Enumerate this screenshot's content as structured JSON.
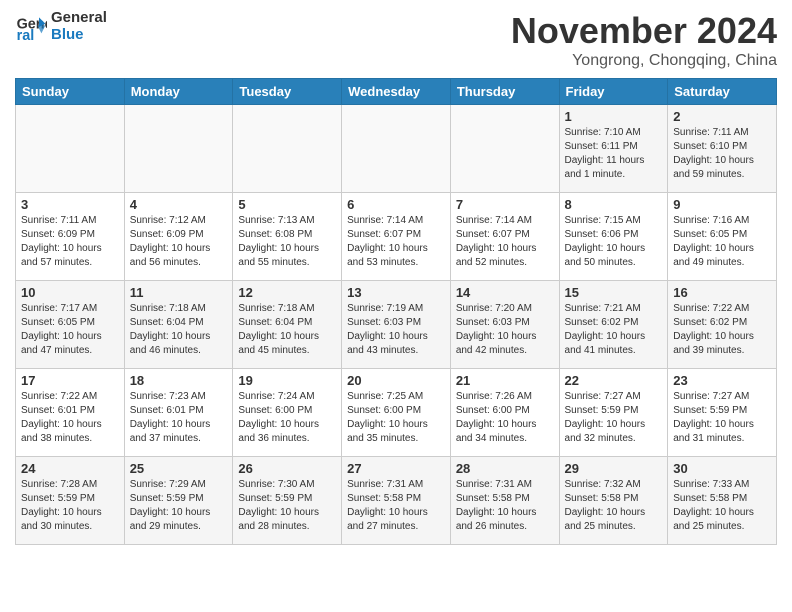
{
  "header": {
    "logo_line1": "General",
    "logo_line2": "Blue",
    "month": "November 2024",
    "location": "Yongrong, Chongqing, China"
  },
  "weekdays": [
    "Sunday",
    "Monday",
    "Tuesday",
    "Wednesday",
    "Thursday",
    "Friday",
    "Saturday"
  ],
  "weeks": [
    [
      {
        "day": "",
        "info": ""
      },
      {
        "day": "",
        "info": ""
      },
      {
        "day": "",
        "info": ""
      },
      {
        "day": "",
        "info": ""
      },
      {
        "day": "",
        "info": ""
      },
      {
        "day": "1",
        "info": "Sunrise: 7:10 AM\nSunset: 6:11 PM\nDaylight: 11 hours\nand 1 minute."
      },
      {
        "day": "2",
        "info": "Sunrise: 7:11 AM\nSunset: 6:10 PM\nDaylight: 10 hours\nand 59 minutes."
      }
    ],
    [
      {
        "day": "3",
        "info": "Sunrise: 7:11 AM\nSunset: 6:09 PM\nDaylight: 10 hours\nand 57 minutes."
      },
      {
        "day": "4",
        "info": "Sunrise: 7:12 AM\nSunset: 6:09 PM\nDaylight: 10 hours\nand 56 minutes."
      },
      {
        "day": "5",
        "info": "Sunrise: 7:13 AM\nSunset: 6:08 PM\nDaylight: 10 hours\nand 55 minutes."
      },
      {
        "day": "6",
        "info": "Sunrise: 7:14 AM\nSunset: 6:07 PM\nDaylight: 10 hours\nand 53 minutes."
      },
      {
        "day": "7",
        "info": "Sunrise: 7:14 AM\nSunset: 6:07 PM\nDaylight: 10 hours\nand 52 minutes."
      },
      {
        "day": "8",
        "info": "Sunrise: 7:15 AM\nSunset: 6:06 PM\nDaylight: 10 hours\nand 50 minutes."
      },
      {
        "day": "9",
        "info": "Sunrise: 7:16 AM\nSunset: 6:05 PM\nDaylight: 10 hours\nand 49 minutes."
      }
    ],
    [
      {
        "day": "10",
        "info": "Sunrise: 7:17 AM\nSunset: 6:05 PM\nDaylight: 10 hours\nand 47 minutes."
      },
      {
        "day": "11",
        "info": "Sunrise: 7:18 AM\nSunset: 6:04 PM\nDaylight: 10 hours\nand 46 minutes."
      },
      {
        "day": "12",
        "info": "Sunrise: 7:18 AM\nSunset: 6:04 PM\nDaylight: 10 hours\nand 45 minutes."
      },
      {
        "day": "13",
        "info": "Sunrise: 7:19 AM\nSunset: 6:03 PM\nDaylight: 10 hours\nand 43 minutes."
      },
      {
        "day": "14",
        "info": "Sunrise: 7:20 AM\nSunset: 6:03 PM\nDaylight: 10 hours\nand 42 minutes."
      },
      {
        "day": "15",
        "info": "Sunrise: 7:21 AM\nSunset: 6:02 PM\nDaylight: 10 hours\nand 41 minutes."
      },
      {
        "day": "16",
        "info": "Sunrise: 7:22 AM\nSunset: 6:02 PM\nDaylight: 10 hours\nand 39 minutes."
      }
    ],
    [
      {
        "day": "17",
        "info": "Sunrise: 7:22 AM\nSunset: 6:01 PM\nDaylight: 10 hours\nand 38 minutes."
      },
      {
        "day": "18",
        "info": "Sunrise: 7:23 AM\nSunset: 6:01 PM\nDaylight: 10 hours\nand 37 minutes."
      },
      {
        "day": "19",
        "info": "Sunrise: 7:24 AM\nSunset: 6:00 PM\nDaylight: 10 hours\nand 36 minutes."
      },
      {
        "day": "20",
        "info": "Sunrise: 7:25 AM\nSunset: 6:00 PM\nDaylight: 10 hours\nand 35 minutes."
      },
      {
        "day": "21",
        "info": "Sunrise: 7:26 AM\nSunset: 6:00 PM\nDaylight: 10 hours\nand 34 minutes."
      },
      {
        "day": "22",
        "info": "Sunrise: 7:27 AM\nSunset: 5:59 PM\nDaylight: 10 hours\nand 32 minutes."
      },
      {
        "day": "23",
        "info": "Sunrise: 7:27 AM\nSunset: 5:59 PM\nDaylight: 10 hours\nand 31 minutes."
      }
    ],
    [
      {
        "day": "24",
        "info": "Sunrise: 7:28 AM\nSunset: 5:59 PM\nDaylight: 10 hours\nand 30 minutes."
      },
      {
        "day": "25",
        "info": "Sunrise: 7:29 AM\nSunset: 5:59 PM\nDaylight: 10 hours\nand 29 minutes."
      },
      {
        "day": "26",
        "info": "Sunrise: 7:30 AM\nSunset: 5:59 PM\nDaylight: 10 hours\nand 28 minutes."
      },
      {
        "day": "27",
        "info": "Sunrise: 7:31 AM\nSunset: 5:58 PM\nDaylight: 10 hours\nand 27 minutes."
      },
      {
        "day": "28",
        "info": "Sunrise: 7:31 AM\nSunset: 5:58 PM\nDaylight: 10 hours\nand 26 minutes."
      },
      {
        "day": "29",
        "info": "Sunrise: 7:32 AM\nSunset: 5:58 PM\nDaylight: 10 hours\nand 25 minutes."
      },
      {
        "day": "30",
        "info": "Sunrise: 7:33 AM\nSunset: 5:58 PM\nDaylight: 10 hours\nand 25 minutes."
      }
    ]
  ]
}
